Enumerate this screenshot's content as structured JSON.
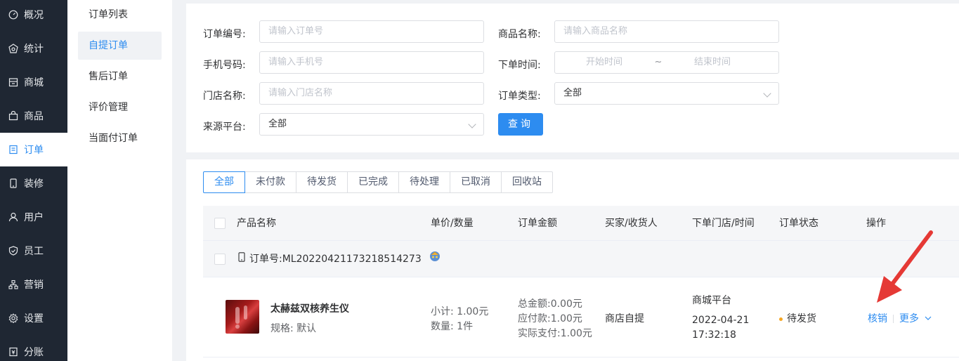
{
  "nav": {
    "items": [
      {
        "label": "概况",
        "icon": "dashboard-icon"
      },
      {
        "label": "统计",
        "icon": "stats-icon"
      },
      {
        "label": "商城",
        "icon": "store-icon"
      },
      {
        "label": "商品",
        "icon": "bag-icon"
      },
      {
        "label": "订单",
        "icon": "order-icon"
      },
      {
        "label": "装修",
        "icon": "phone-icon"
      },
      {
        "label": "用户",
        "icon": "user-icon"
      },
      {
        "label": "员工",
        "icon": "shield-icon"
      },
      {
        "label": "营销",
        "icon": "sitemap-icon"
      },
      {
        "label": "设置",
        "icon": "gear-icon"
      },
      {
        "label": "分账",
        "icon": "ledger-icon"
      }
    ],
    "active_index": 4
  },
  "submenu": {
    "items": [
      "订单列表",
      "自提订单",
      "售后订单",
      "评价管理",
      "当面付订单"
    ],
    "active_index": 1
  },
  "filters": {
    "order_no": {
      "label": "订单编号:",
      "placeholder": "请输入订单号"
    },
    "product_name": {
      "label": "商品名称:",
      "placeholder": "请输入商品名称"
    },
    "phone": {
      "label": "手机号码:",
      "placeholder": "请输入手机号"
    },
    "order_time": {
      "label": "下单时间:",
      "start_placeholder": "开始时间",
      "separator": "~",
      "end_placeholder": "结束时间"
    },
    "store_name": {
      "label": "门店名称:",
      "placeholder": "请输入门店名称"
    },
    "order_type": {
      "label": "订单类型:",
      "value": "全部"
    },
    "source": {
      "label": "来源平台:",
      "value": "全部"
    },
    "query_button": "查询"
  },
  "tabs": [
    "全部",
    "未付款",
    "待发货",
    "已完成",
    "待处理",
    "已取消",
    "回收站"
  ],
  "active_tab": 0,
  "table": {
    "headers": [
      "产品名称",
      "单价/数量",
      "订单金额",
      "买家/收货人",
      "下单门店/时间",
      "订单状态",
      "操作"
    ],
    "order": {
      "order_no_label": "订单号:",
      "order_no": "ML20220421173218514273",
      "product_title": "太赫兹双核养生仪",
      "spec": "规格:  默认",
      "subtotal": "小计:  1.00元",
      "quantity": "数量:  1件",
      "total": "总金额:0.00元",
      "payable": "应付款:1.00元",
      "paid": "实际支付:1.00元",
      "buyer": "商店自提",
      "store": "商城平台",
      "date": "2022-04-21",
      "time": "17:32:18",
      "status": "待发货",
      "action_verify": "核销",
      "action_more": "更多"
    }
  },
  "colors": {
    "accent": "#2d8cf0",
    "nav_bg": "#1f2733",
    "status_dot": "#f5a623",
    "arrow": "#e53935"
  }
}
